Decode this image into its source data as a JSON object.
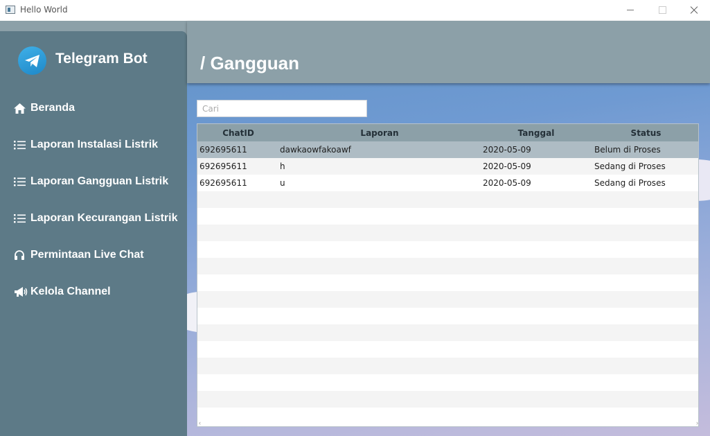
{
  "window": {
    "title": "Hello World"
  },
  "brand": {
    "title": "Telegram Bot",
    "logo_icon": "telegram-icon"
  },
  "nav": [
    {
      "label": "Beranda",
      "icon": "home-icon"
    },
    {
      "label": "Laporan Instalasi Listrik",
      "icon": "list-icon"
    },
    {
      "label": "Laporan Gangguan Listrik",
      "icon": "list-icon"
    },
    {
      "label": "Laporan Kecurangan Listrik",
      "icon": "list-icon"
    },
    {
      "label": "Permintaan Live Chat",
      "icon": "headphones-icon"
    },
    {
      "label": "Kelola Channel",
      "icon": "megaphone-icon"
    }
  ],
  "header": {
    "title": "/ Gangguan"
  },
  "search": {
    "placeholder": "Cari",
    "value": ""
  },
  "table": {
    "columns": [
      "ChatID",
      "Laporan",
      "Tanggal",
      "Status"
    ],
    "rows": [
      [
        "692695611",
        "dawkaowfakoawf",
        "2020-05-09",
        "Belum di Proses"
      ],
      [
        "692695611",
        "h",
        "2020-05-09",
        "Sedang di Proses"
      ],
      [
        "692695611",
        "u",
        "2020-05-09",
        "Sedang di Proses"
      ]
    ],
    "selected_row": 0
  },
  "colors": {
    "sidebar": "#5d7a87",
    "header": "#8ca0a8",
    "selected_row": "#aebcc4",
    "telegram": "#2a9ddc"
  }
}
